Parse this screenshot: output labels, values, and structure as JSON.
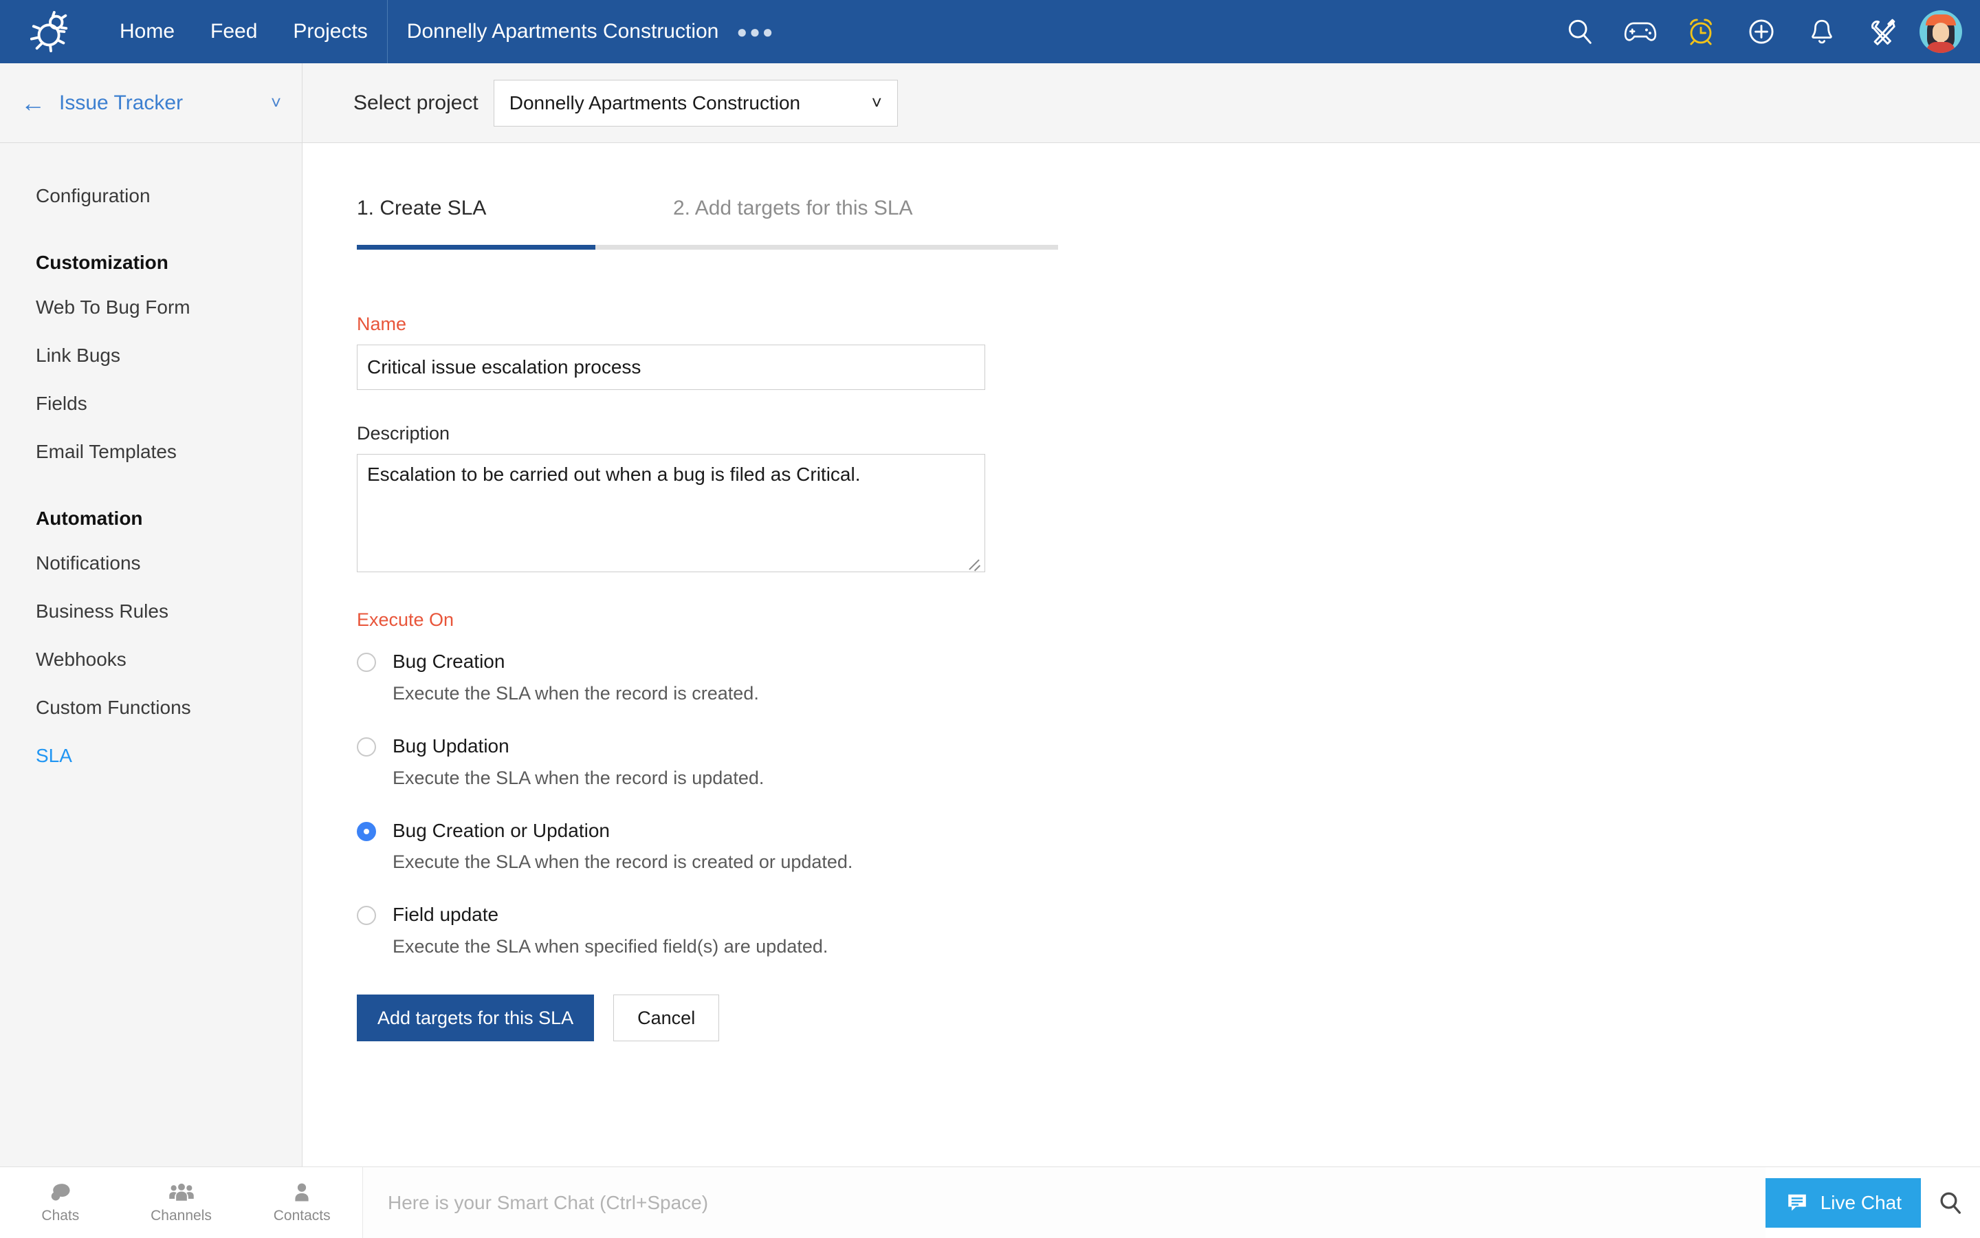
{
  "topbar": {
    "logo_icon": "bug-icon",
    "nav": [
      {
        "label": "Home"
      },
      {
        "label": "Feed"
      },
      {
        "label": "Projects"
      }
    ],
    "project_title": "Donnelly Apartments Construction",
    "overflow_label": "●●●",
    "icons": [
      {
        "name": "search-icon"
      },
      {
        "name": "gamepad-icon"
      },
      {
        "name": "alarm-clock-icon",
        "color": "#f2c31a"
      },
      {
        "name": "add-circle-icon"
      },
      {
        "name": "bell-icon"
      },
      {
        "name": "tools-icon"
      }
    ],
    "avatar_name": "user-avatar"
  },
  "subheader": {
    "back_icon": "back-arrow-icon",
    "app_name": "Issue Tracker",
    "app_caret_icon": "chevron-down-icon",
    "select_label": "Select project",
    "selected_project": "Donnelly Apartments Construction",
    "select_caret_icon": "chevron-down-icon"
  },
  "sidebar": {
    "items": [
      {
        "label": "Configuration",
        "type": "item",
        "active": false
      },
      {
        "label": "Customization",
        "type": "heading"
      },
      {
        "label": "Web To Bug Form",
        "type": "item",
        "active": false
      },
      {
        "label": "Link Bugs",
        "type": "item",
        "active": false
      },
      {
        "label": "Fields",
        "type": "item",
        "active": false
      },
      {
        "label": "Email Templates",
        "type": "item",
        "active": false
      },
      {
        "label": "Automation",
        "type": "heading"
      },
      {
        "label": "Notifications",
        "type": "item",
        "active": false
      },
      {
        "label": "Business Rules",
        "type": "item",
        "active": false
      },
      {
        "label": "Webhooks",
        "type": "item",
        "active": false
      },
      {
        "label": "Custom Functions",
        "type": "item",
        "active": false
      },
      {
        "label": "SLA",
        "type": "item",
        "active": true
      }
    ]
  },
  "main": {
    "tabs": [
      {
        "label": "1. Create SLA",
        "active": true
      },
      {
        "label": "2. Add targets for this SLA",
        "active": false
      }
    ],
    "form": {
      "name_label": "Name",
      "name_value": "Critical issue escalation process",
      "description_label": "Description",
      "description_value": "Escalation to be carried out when a bug is filed as Critical.",
      "execute_on_label": "Execute On",
      "options": [
        {
          "title": "Bug Creation",
          "description": "Execute the SLA when the record is created.",
          "selected": false
        },
        {
          "title": "Bug Updation",
          "description": "Execute the SLA when the record is updated.",
          "selected": false
        },
        {
          "title": "Bug Creation or Updation",
          "description": "Execute the SLA when the record is created or updated.",
          "selected": true
        },
        {
          "title": "Field update",
          "description": "Execute the SLA when specified field(s) are updated.",
          "selected": false
        }
      ],
      "submit_label": "Add targets for this SLA",
      "cancel_label": "Cancel"
    }
  },
  "chatbar": {
    "tabs": [
      {
        "label": "Chats",
        "icon": "chat-bubble-icon"
      },
      {
        "label": "Channels",
        "icon": "group-people-icon"
      },
      {
        "label": "Contacts",
        "icon": "person-icon"
      }
    ],
    "smart_chat_placeholder": "Here is your Smart Chat (Ctrl+Space)",
    "live_chat_label": "Live Chat",
    "live_chat_icon": "chat-lines-icon",
    "search_icon": "search-icon"
  },
  "colors": {
    "header_blue": "#215599",
    "accent_blue": "#1f5296",
    "link_blue": "#3c7fd0",
    "active_nav": "#2196f3",
    "required_red": "#e8553a",
    "radio_selected": "#3b82f6",
    "live_chat_blue": "#29a3e6",
    "alarm_yellow": "#f2c31a"
  }
}
